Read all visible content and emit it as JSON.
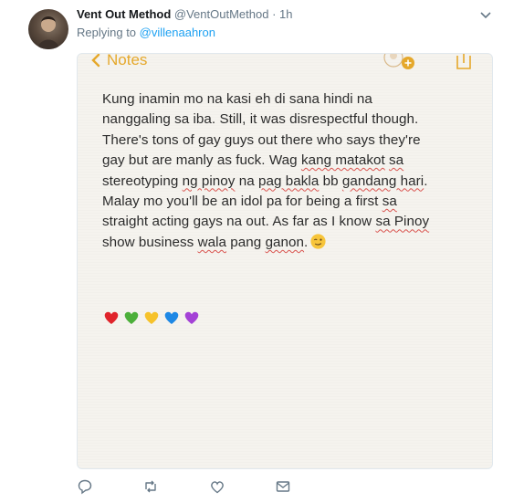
{
  "tweet": {
    "author_name": "Vent Out Method",
    "author_handle": "@VentOutMethod",
    "separator": "·",
    "time": "1h",
    "replying_prefix": "Replying to",
    "replying_to": "@villenaahron"
  },
  "note": {
    "back_label": "Notes",
    "lines": [
      "Kung inamin mo na kasi eh di sana hindi na",
      "nanggaling sa iba. Still, it was disrespectful though.",
      "There's tons of gay guys out there who says they're",
      "gay but are manly as fuck. Wag",
      "kang matakot",
      "sa",
      "stereotyping",
      "ng pinoy",
      "na",
      "pag bakla",
      "bb",
      "gandang hari",
      "Malay mo you'll be an idol pa for being a first",
      "sa",
      "straight acting gays na out. As far as I know",
      "sa Pinoy",
      "show business",
      "wala",
      "pang",
      "ganon",
      "."
    ],
    "emoji_row": [
      "red-heart",
      "green-heart",
      "yellow-heart",
      "blue-heart",
      "purple-heart"
    ],
    "inline_emoji": "winking-face"
  },
  "colors": {
    "accent_link": "#1da1f2",
    "notes_accent": "#e5a82b",
    "muted": "#657786",
    "spellcheck": "#d9534f"
  },
  "actions": [
    "reply-icon",
    "retweet-icon",
    "like-icon",
    "direct-message-icon"
  ]
}
